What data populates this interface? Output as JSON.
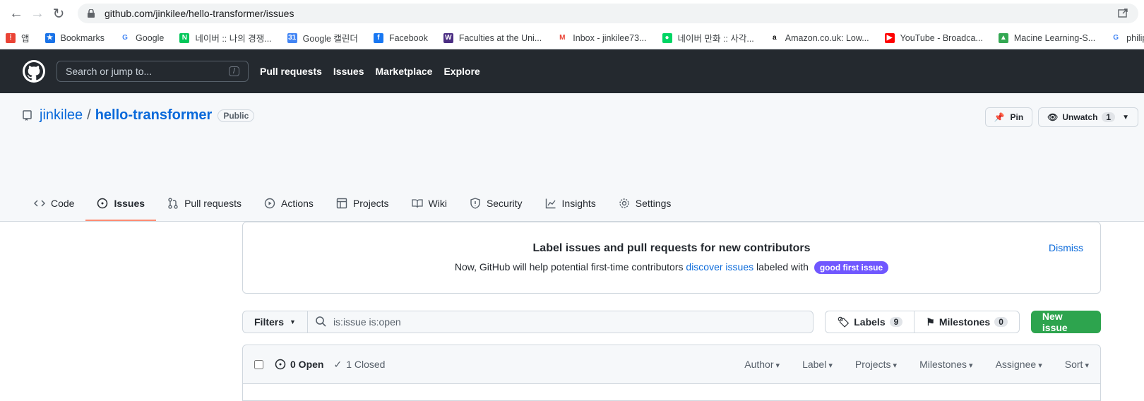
{
  "browser": {
    "url": "github.com/jinkilee/hello-transformer/issues",
    "bookmarks": [
      {
        "label": "앱",
        "icon": "apps-icon"
      },
      {
        "label": "Bookmarks",
        "icon": "star-icon"
      },
      {
        "label": "Google",
        "icon": "google-icon"
      },
      {
        "label": "네이버 :: 나의 경쟁...",
        "icon": "naver-icon"
      },
      {
        "label": "Google 캘린더",
        "icon": "calendar-icon"
      },
      {
        "label": "Facebook",
        "icon": "facebook-icon"
      },
      {
        "label": "Faculties at the Uni...",
        "icon": "w-icon"
      },
      {
        "label": "Inbox - jinkilee73...",
        "icon": "gmail-icon"
      },
      {
        "label": "네이버 만화 :: 사각...",
        "icon": "webtoon-icon"
      },
      {
        "label": "Amazon.co.uk: Low...",
        "icon": "amazon-icon"
      },
      {
        "label": "YouTube - Broadca...",
        "icon": "youtube-icon"
      },
      {
        "label": "Macine Learning-S...",
        "icon": "drive-icon"
      },
      {
        "label": "philippeadjiman",
        "icon": "google-icon"
      }
    ]
  },
  "header": {
    "search_placeholder": "Search or jump to...",
    "search_shortcut": "/",
    "nav": [
      "Pull requests",
      "Issues",
      "Marketplace",
      "Explore"
    ]
  },
  "repo": {
    "owner": "jinkilee",
    "separator": "/",
    "name": "hello-transformer",
    "visibility": "Public",
    "pin_label": "Pin",
    "unwatch_label": "Unwatch",
    "watch_count": "1"
  },
  "tabs": [
    {
      "label": "Code",
      "icon": "code-icon"
    },
    {
      "label": "Issues",
      "icon": "issue-icon",
      "active": true
    },
    {
      "label": "Pull requests",
      "icon": "pr-icon"
    },
    {
      "label": "Actions",
      "icon": "play-icon"
    },
    {
      "label": "Projects",
      "icon": "table-icon"
    },
    {
      "label": "Wiki",
      "icon": "book-icon"
    },
    {
      "label": "Security",
      "icon": "shield-icon"
    },
    {
      "label": "Insights",
      "icon": "graph-icon"
    },
    {
      "label": "Settings",
      "icon": "gear-icon"
    }
  ],
  "banner": {
    "title": "Label issues and pull requests for new contributors",
    "text_before": "Now, GitHub will help potential first-time contributors",
    "link": "discover issues",
    "text_after": "labeled with",
    "label": "good first issue",
    "dismiss": "Dismiss"
  },
  "filters": {
    "button": "Filters",
    "query": "is:issue is:open",
    "labels": "Labels",
    "labels_count": "9",
    "milestones": "Milestones",
    "milestones_count": "0",
    "new_issue": "New issue"
  },
  "list": {
    "open": "0 Open",
    "closed": "1 Closed",
    "sorts": [
      "Author",
      "Label",
      "Projects",
      "Milestones",
      "Assignee",
      "Sort"
    ]
  },
  "colors": {
    "header_bg": "#24292f",
    "accent": "#fd8c73",
    "green": "#2da44e",
    "gfi": "#7057ff"
  }
}
